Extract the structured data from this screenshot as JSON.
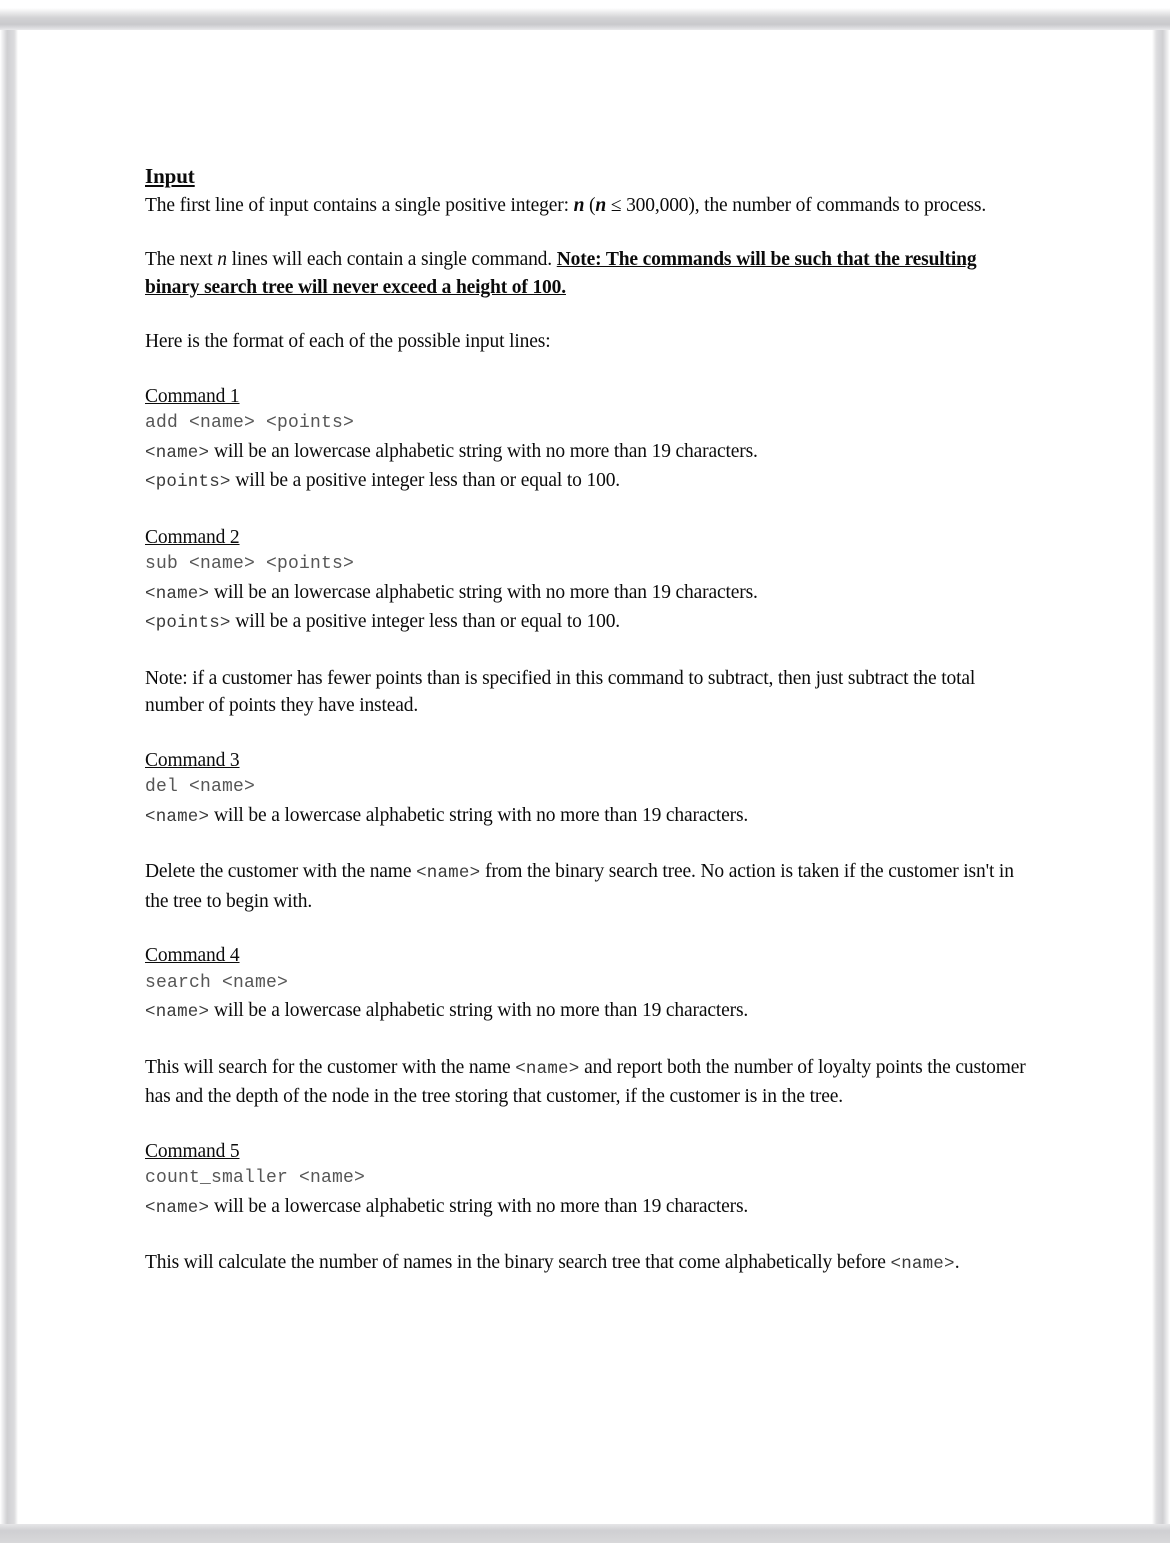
{
  "document": {
    "section_heading": "Input",
    "intro": {
      "prefix": "The first line of input contains a single positive integer: ",
      "var_n": "n",
      "constraint_open": " (",
      "constraint_var": "n",
      "constraint_rest": " ≤ 300,000), the number of commands to process."
    },
    "next_lines": {
      "prefix": "The next ",
      "var_n": "n",
      "mid": " lines will each contain a single command. ",
      "note_bold": "Note: The commands will be such that the resulting binary search tree will never exceed a height of 100."
    },
    "format_intro": "Here is the format of each of the possible input lines:",
    "commands": [
      {
        "heading": "Command 1",
        "syntax": "add <name> <points>",
        "specs": [
          {
            "token": "<name>",
            "text": " will be an lowercase alphabetic string with no more than 19 characters."
          },
          {
            "token": "<points>",
            "text": " will be a positive integer less than or equal to 100."
          }
        ],
        "notes": []
      },
      {
        "heading": "Command 2",
        "syntax": "sub <name> <points>",
        "specs": [
          {
            "token": "<name>",
            "text": " will be an lowercase alphabetic string with no more than 19 characters."
          },
          {
            "token": "<points>",
            "text": " will be a positive integer less than or equal to 100."
          }
        ],
        "notes": [
          {
            "before": "Note: if a customer has fewer points than is specified in this command to subtract, then just subtract the total number of points they have instead.",
            "token": "",
            "after": ""
          }
        ]
      },
      {
        "heading": "Command 3",
        "syntax": "del <name>",
        "specs": [
          {
            "token": "<name>",
            "text": " will be a lowercase alphabetic string with no more than 19 characters."
          }
        ],
        "notes": [
          {
            "before": "Delete the customer with the name ",
            "token": "<name>",
            "after": " from the binary search tree. No action is taken if the customer isn't in the tree to begin with."
          }
        ]
      },
      {
        "heading": "Command 4",
        "syntax": "search <name>",
        "specs": [
          {
            "token": "<name>",
            "text": " will be a lowercase alphabetic string with no more than 19 characters."
          }
        ],
        "notes": [
          {
            "before": "This will search for the customer with the name ",
            "token": "<name>",
            "after": " and report both the number of loyalty points the customer has and the depth of the node in the tree storing that customer, if the customer is in the tree."
          }
        ]
      },
      {
        "heading": "Command 5",
        "syntax": "count_smaller <name>",
        "specs": [
          {
            "token": "<name>",
            "text": " will be a lowercase alphabetic string with no more than 19 characters."
          }
        ],
        "notes": [
          {
            "before": "This will calculate the number of names in the binary search tree that come alphabetically before ",
            "token": "<name>",
            "after": "."
          }
        ]
      }
    ]
  }
}
